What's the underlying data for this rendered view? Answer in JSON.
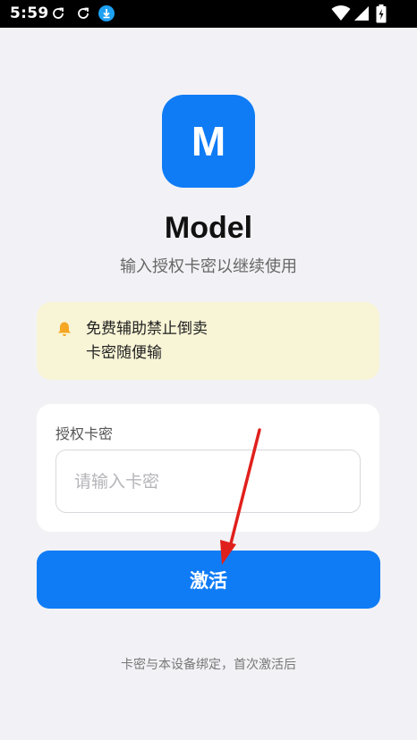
{
  "status_bar": {
    "time": "5:59",
    "icons": [
      "refresh-icon",
      "refresh-icon",
      "download-icon",
      "wifi-icon",
      "signal-icon",
      "battery-charging-icon"
    ]
  },
  "app": {
    "logo_letter": "M",
    "title": "Model",
    "subtitle": "输入授权卡密以继续使用"
  },
  "notice": {
    "icon": "bell-icon",
    "text": "免费辅助禁止倒卖\n卡密随便输"
  },
  "form": {
    "label": "授权卡密",
    "input_value": "",
    "input_placeholder": "请输入卡密"
  },
  "activate_button": {
    "label": "激活"
  },
  "footer": {
    "note": "卡密与本设备绑定，首次激活后"
  },
  "colors": {
    "accent": "#0f7cf6",
    "notice_bg": "#f8f4d6",
    "bell": "#f5a623",
    "page_bg": "#f2f2f6",
    "annotation_arrow": "#e0201c"
  }
}
